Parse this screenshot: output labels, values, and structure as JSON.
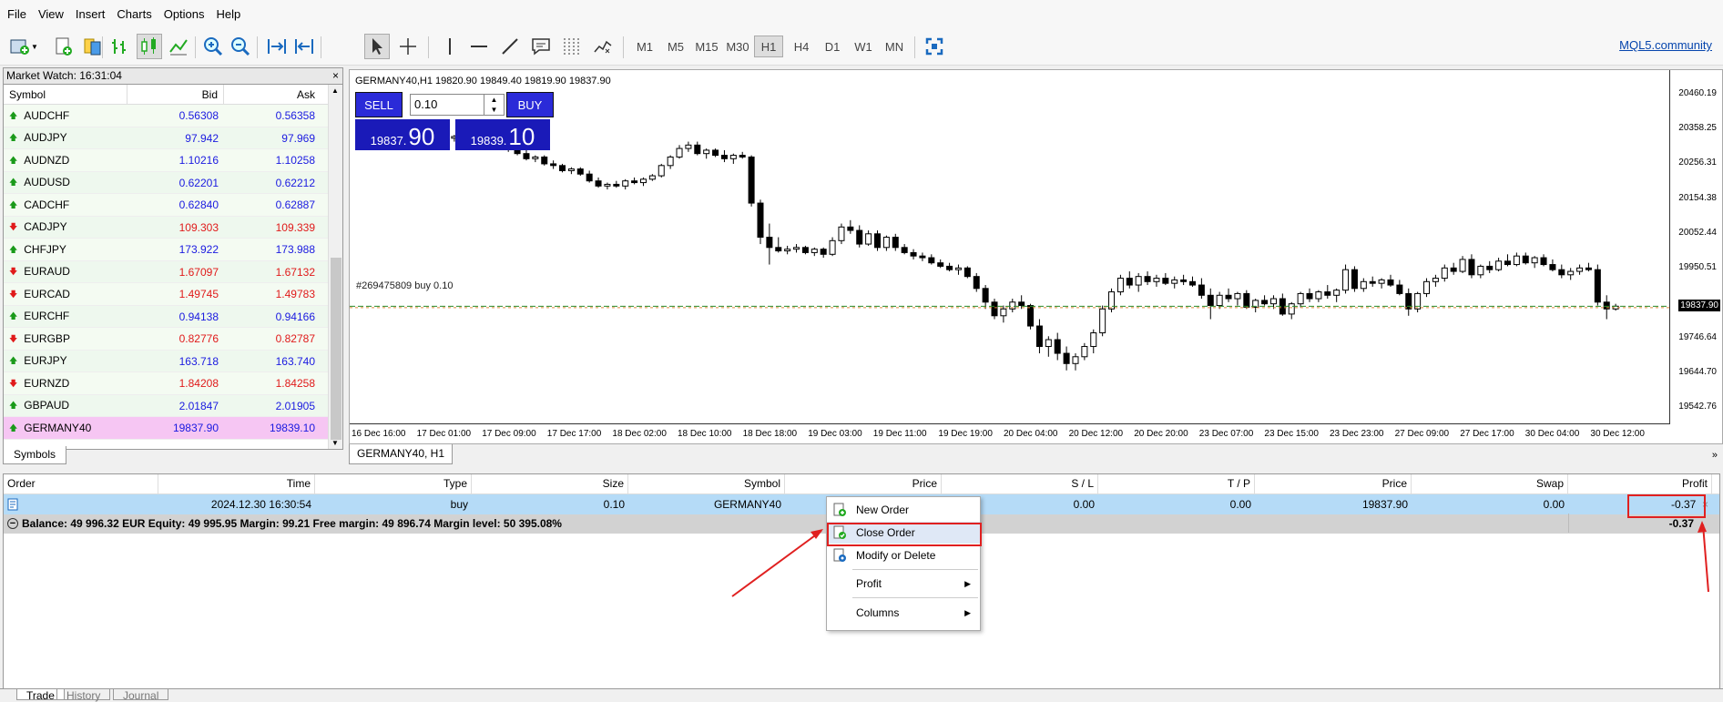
{
  "menu": [
    "File",
    "View",
    "Insert",
    "Charts",
    "Options",
    "Help"
  ],
  "toolbar": {
    "timeframes": [
      "M1",
      "M5",
      "M15",
      "M30",
      "H1",
      "H4",
      "D1",
      "W1",
      "MN"
    ],
    "active_timeframe": "H1",
    "community_link": "MQL5.community"
  },
  "market_watch": {
    "title": "Market Watch: 16:31:04",
    "close_glyph": "×",
    "headers": {
      "symbol": "Symbol",
      "bid": "Bid",
      "ask": "Ask"
    },
    "rows": [
      {
        "symbol": "AUDCHF",
        "bid": "0.56308",
        "ask": "0.56358",
        "dir": "up"
      },
      {
        "symbol": "AUDJPY",
        "bid": "97.942",
        "ask": "97.969",
        "dir": "up"
      },
      {
        "symbol": "AUDNZD",
        "bid": "1.10216",
        "ask": "1.10258",
        "dir": "up"
      },
      {
        "symbol": "AUDUSD",
        "bid": "0.62201",
        "ask": "0.62212",
        "dir": "up"
      },
      {
        "symbol": "CADCHF",
        "bid": "0.62840",
        "ask": "0.62887",
        "dir": "up"
      },
      {
        "symbol": "CADJPY",
        "bid": "109.303",
        "ask": "109.339",
        "dir": "down"
      },
      {
        "symbol": "CHFJPY",
        "bid": "173.922",
        "ask": "173.988",
        "dir": "up"
      },
      {
        "symbol": "EURAUD",
        "bid": "1.67097",
        "ask": "1.67132",
        "dir": "down"
      },
      {
        "symbol": "EURCAD",
        "bid": "1.49745",
        "ask": "1.49783",
        "dir": "down"
      },
      {
        "symbol": "EURCHF",
        "bid": "0.94138",
        "ask": "0.94166",
        "dir": "up"
      },
      {
        "symbol": "EURGBP",
        "bid": "0.82776",
        "ask": "0.82787",
        "dir": "down"
      },
      {
        "symbol": "EURJPY",
        "bid": "163.718",
        "ask": "163.740",
        "dir": "up"
      },
      {
        "symbol": "EURNZD",
        "bid": "1.84208",
        "ask": "1.84258",
        "dir": "down"
      },
      {
        "symbol": "GBPAUD",
        "bid": "2.01847",
        "ask": "2.01905",
        "dir": "up"
      },
      {
        "symbol": "GERMANY40",
        "bid": "19837.90",
        "ask": "19839.10",
        "dir": "up",
        "selected": true
      }
    ],
    "tab": "Symbols"
  },
  "chart": {
    "header": "GERMANY40,H1  19820.90  19849.40  19819.90  19837.90",
    "sell_label": "SELL",
    "buy_label": "BUY",
    "lot": "0.10",
    "sell_price_small": "19837.",
    "sell_price_big": "90",
    "buy_price_small": "19839.",
    "buy_price_big": "10",
    "order_line_label": "#269475809 buy 0.10",
    "y_labels": [
      "20460.19",
      "20358.25",
      "20256.31",
      "20154.38",
      "20052.44",
      "19950.51",
      "19746.64",
      "19644.70",
      "19542.76"
    ],
    "current_price_label": "19837.90",
    "x_labels": [
      "16 Dec 16:00",
      "17 Dec 01:00",
      "17 Dec 09:00",
      "17 Dec 17:00",
      "18 Dec 02:00",
      "18 Dec 10:00",
      "18 Dec 18:00",
      "19 Dec 03:00",
      "19 Dec 11:00",
      "19 Dec 19:00",
      "20 Dec 04:00",
      "20 Dec 12:00",
      "20 Dec 20:00",
      "23 Dec 07:00",
      "23 Dec 15:00",
      "23 Dec 23:00",
      "27 Dec 09:00",
      "27 Dec 17:00",
      "30 Dec 04:00",
      "30 Dec 12:00"
    ],
    "tab": "GERMANY40, H1",
    "candles": [
      [
        20340,
        20345,
        20325,
        20330
      ],
      [
        20330,
        20340,
        20320,
        20335
      ],
      [
        20335,
        20345,
        20315,
        20320
      ],
      [
        20320,
        20330,
        20310,
        20325
      ],
      [
        20325,
        20335,
        20310,
        20315
      ],
      [
        20315,
        20325,
        20300,
        20310
      ],
      [
        20310,
        20320,
        20295,
        20300
      ],
      [
        20300,
        20310,
        20290,
        20305
      ],
      [
        20305,
        20310,
        20280,
        20285
      ],
      [
        20285,
        20295,
        20265,
        20270
      ],
      [
        20270,
        20280,
        20260,
        20275
      ],
      [
        20275,
        20280,
        20250,
        20255
      ],
      [
        20255,
        20265,
        20240,
        20250
      ],
      [
        20250,
        20255,
        20230,
        20235
      ],
      [
        20235,
        20245,
        20225,
        20240
      ],
      [
        20240,
        20245,
        20220,
        20225
      ],
      [
        20225,
        20235,
        20200,
        20205
      ],
      [
        20205,
        20215,
        20185,
        20190
      ],
      [
        20190,
        20200,
        20180,
        20195
      ],
      [
        20195,
        20205,
        20185,
        20190
      ],
      [
        20190,
        20210,
        20180,
        20205
      ],
      [
        20205,
        20215,
        20195,
        20200
      ],
      [
        20200,
        20215,
        20190,
        20210
      ],
      [
        20210,
        20225,
        20205,
        20220
      ],
      [
        20220,
        20255,
        20215,
        20250
      ],
      [
        20250,
        20280,
        20240,
        20275
      ],
      [
        20275,
        20310,
        20270,
        20300
      ],
      [
        20300,
        20320,
        20290,
        20310
      ],
      [
        20310,
        20320,
        20280,
        20285
      ],
      [
        20285,
        20300,
        20270,
        20295
      ],
      [
        20295,
        20300,
        20275,
        20280
      ],
      [
        20280,
        20295,
        20260,
        20270
      ],
      [
        20270,
        20285,
        20255,
        20280
      ],
      [
        20280,
        20290,
        20270,
        20275
      ],
      [
        20275,
        20280,
        20130,
        20140
      ],
      [
        20140,
        20150,
        20020,
        20040
      ],
      [
        20040,
        20080,
        19960,
        20010
      ],
      [
        20010,
        20040,
        19995,
        20000
      ],
      [
        20000,
        20015,
        19990,
        20005
      ],
      [
        20005,
        20020,
        19995,
        20010
      ],
      [
        20010,
        20015,
        19990,
        19995
      ],
      [
        19995,
        20010,
        19985,
        20005
      ],
      [
        20005,
        20010,
        19980,
        19990
      ],
      [
        19990,
        20040,
        19985,
        20030
      ],
      [
        20030,
        20080,
        20020,
        20070
      ],
      [
        20070,
        20090,
        20050,
        20060
      ],
      [
        20060,
        20075,
        20010,
        20020
      ],
      [
        20020,
        20060,
        20015,
        20050
      ],
      [
        20050,
        20060,
        20000,
        20010
      ],
      [
        20010,
        20045,
        20000,
        20040
      ],
      [
        20040,
        20050,
        20000,
        20010
      ],
      [
        20010,
        20020,
        19990,
        19995
      ],
      [
        19995,
        20005,
        19975,
        19985
      ],
      [
        19985,
        19995,
        19970,
        19980
      ],
      [
        19980,
        19990,
        19960,
        19965
      ],
      [
        19965,
        19975,
        19950,
        19955
      ],
      [
        19955,
        19965,
        19940,
        19945
      ],
      [
        19945,
        19960,
        19930,
        19950
      ],
      [
        19950,
        19955,
        19920,
        19925
      ],
      [
        19925,
        19935,
        19880,
        19890
      ],
      [
        19890,
        19900,
        19830,
        19850
      ],
      [
        19850,
        19860,
        19800,
        19810
      ],
      [
        19810,
        19840,
        19790,
        19830
      ],
      [
        19830,
        19860,
        19820,
        19850
      ],
      [
        19850,
        19870,
        19830,
        19840
      ],
      [
        19840,
        19845,
        19770,
        19780
      ],
      [
        19780,
        19800,
        19700,
        19720
      ],
      [
        19720,
        19750,
        19690,
        19740
      ],
      [
        19740,
        19760,
        19680,
        19700
      ],
      [
        19700,
        19720,
        19650,
        19670
      ],
      [
        19670,
        19700,
        19650,
        19690
      ],
      [
        19690,
        19730,
        19680,
        19720
      ],
      [
        19720,
        19770,
        19700,
        19760
      ],
      [
        19760,
        19840,
        19750,
        19830
      ],
      [
        19830,
        19890,
        19820,
        19880
      ],
      [
        19880,
        19930,
        19870,
        19920
      ],
      [
        19920,
        19940,
        19890,
        19900
      ],
      [
        19900,
        19935,
        19880,
        19925
      ],
      [
        19925,
        19940,
        19900,
        19910
      ],
      [
        19910,
        19930,
        19895,
        19920
      ],
      [
        19920,
        19935,
        19900,
        19905
      ],
      [
        19905,
        19925,
        19890,
        19915
      ],
      [
        19915,
        19930,
        19900,
        19910
      ],
      [
        19910,
        19925,
        19895,
        19900
      ],
      [
        19900,
        19920,
        19860,
        19870
      ],
      [
        19870,
        19890,
        19800,
        19840
      ],
      [
        19840,
        19880,
        19830,
        19870
      ],
      [
        19870,
        19890,
        19850,
        19860
      ],
      [
        19860,
        19880,
        19840,
        19875
      ],
      [
        19875,
        19885,
        19830,
        19835
      ],
      [
        19835,
        19860,
        19820,
        19855
      ],
      [
        19855,
        19870,
        19840,
        19845
      ],
      [
        19845,
        19870,
        19830,
        19860
      ],
      [
        19860,
        19875,
        19810,
        19815
      ],
      [
        19815,
        19850,
        19800,
        19845
      ],
      [
        19845,
        19880,
        19835,
        19875
      ],
      [
        19875,
        19890,
        19850,
        19860
      ],
      [
        19860,
        19885,
        19850,
        19880
      ],
      [
        19880,
        19900,
        19860,
        19870
      ],
      [
        19870,
        19890,
        19850,
        19885
      ],
      [
        19885,
        19960,
        19875,
        19945
      ],
      [
        19945,
        19955,
        19880,
        19890
      ],
      [
        19890,
        19920,
        19880,
        19910
      ],
      [
        19910,
        19925,
        19895,
        19905
      ],
      [
        19905,
        19920,
        19890,
        19915
      ],
      [
        19915,
        19930,
        19895,
        19900
      ],
      [
        19900,
        19915,
        19870,
        19875
      ],
      [
        19875,
        19890,
        19810,
        19830
      ],
      [
        19830,
        19880,
        19820,
        19875
      ],
      [
        19875,
        19920,
        19865,
        19910
      ],
      [
        19910,
        19930,
        19895,
        19920
      ],
      [
        19920,
        19960,
        19910,
        19950
      ],
      [
        19950,
        19965,
        19930,
        19940
      ],
      [
        19940,
        19985,
        19935,
        19975
      ],
      [
        19975,
        19990,
        19920,
        19930
      ],
      [
        19930,
        19960,
        19920,
        19955
      ],
      [
        19955,
        19970,
        19935,
        19945
      ],
      [
        19945,
        19980,
        19940,
        19970
      ],
      [
        19970,
        19990,
        19955,
        19960
      ],
      [
        19960,
        19995,
        19955,
        19985
      ],
      [
        19985,
        19995,
        19960,
        19965
      ],
      [
        19965,
        19985,
        19950,
        19980
      ],
      [
        19980,
        19990,
        19955,
        19960
      ],
      [
        19960,
        19975,
        19940,
        19945
      ],
      [
        19945,
        19960,
        19920,
        19930
      ],
      [
        19930,
        19950,
        19915,
        19940
      ],
      [
        19940,
        19960,
        19930,
        19950
      ],
      [
        19950,
        19965,
        19940,
        19945
      ],
      [
        19945,
        19960,
        19840,
        19850
      ],
      [
        19850,
        19870,
        19800,
        19830
      ],
      [
        19830,
        19845,
        19825,
        19838
      ]
    ]
  },
  "terminal": {
    "headers": [
      "Order",
      "Time",
      "Type",
      "Size",
      "Symbol",
      "Price",
      "S / L",
      "T / P",
      "Price",
      "Swap",
      "Profit"
    ],
    "row": {
      "order": "",
      "time": "2024.12.30 16:30:54",
      "type": "buy",
      "size": "0.10",
      "symbol": "GERMANY40",
      "price": "",
      "sl": "0.00",
      "tp": "0.00",
      "price2": "19837.90",
      "swap": "0.00",
      "profit": "-0.37",
      "close_glyph": "×"
    },
    "balance_text": "Balance: 49 996.32 EUR  Equity: 49 995.95  Margin: 99.21  Free margin: 49 896.74  Margin level: 50 395.08%",
    "balance_profit": "-0.37",
    "tabs": [
      "Trade",
      "History",
      "Journal"
    ]
  },
  "context_menu": {
    "items": [
      "New Order",
      "Close Order",
      "Modify or Delete",
      "Profit",
      "Columns"
    ]
  },
  "colors": {
    "up": "#1a9a1a",
    "down": "#e01a1a",
    "accent": "#2a2ad8",
    "highlight": "#e02020"
  }
}
